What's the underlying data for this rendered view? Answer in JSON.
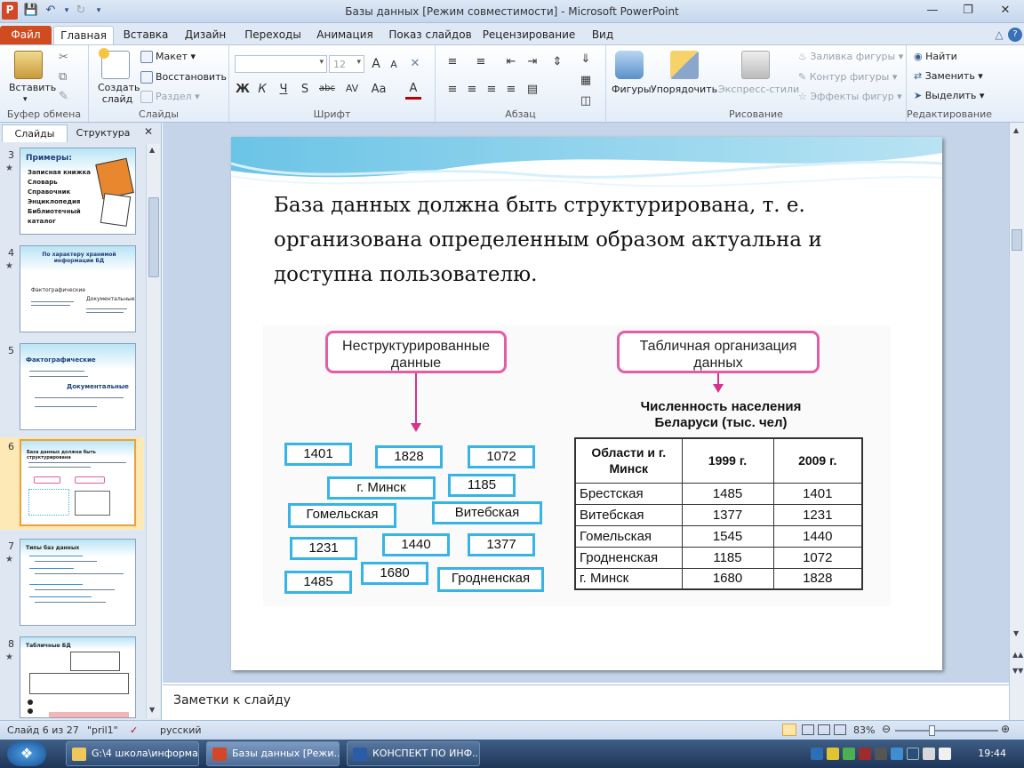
{
  "window": {
    "title": "Базы данных [Режим совместимости]  -  Microsoft PowerPoint",
    "app_icon": "P"
  },
  "ribbon_tabs": [
    "Файл",
    "Главная",
    "Вставка",
    "Дизайн",
    "Переходы",
    "Анимация",
    "Показ слайдов",
    "Рецензирование",
    "Вид"
  ],
  "ribbon": {
    "clipboard": {
      "paste": "Вставить",
      "group": "Буфер обмена"
    },
    "slides": {
      "new_slide": "Создать слайд",
      "layout": "Макет",
      "reset": "Восстановить",
      "section": "Раздел",
      "group": "Слайды"
    },
    "font": {
      "font_size": "12",
      "group": "Шрифт",
      "bold": "Ж",
      "italic": "К",
      "underline": "Ч",
      "shadow": "S",
      "strike": "abc",
      "spacing": "AV",
      "case": "Aa",
      "grow": "A",
      "shrink": "A",
      "color": "A"
    },
    "paragraph": {
      "group": "Абзац"
    },
    "drawing": {
      "shapes": "Фигуры",
      "arrange": "Упорядочить",
      "quick_styles": "Экспресс-стили",
      "fill": "Заливка фигуры",
      "outline": "Контур фигуры",
      "effects": "Эффекты фигур",
      "group": "Рисование"
    },
    "editing": {
      "find": "Найти",
      "replace": "Заменить",
      "select": "Выделить",
      "group": "Редактирование"
    }
  },
  "panel": {
    "tab_slides": "Слайды",
    "tab_outline": "Структура",
    "thumbnails": [
      {
        "num": "3",
        "title": "Примеры:",
        "lines": [
          "Записная книжка",
          "Словарь",
          "Справочник",
          "Энциклопедия",
          "Библиотечный каталог"
        ]
      },
      {
        "num": "4",
        "title": "По характеру хранимой информации БД",
        "lines": [
          "Фактографические",
          "Документальные"
        ]
      },
      {
        "num": "5",
        "title": "Фактографические",
        "lines": [
          "Документальные"
        ]
      },
      {
        "num": "6",
        "title": "База данных должна быть структурирована",
        "lines": []
      },
      {
        "num": "7",
        "title": "Типы баз данных",
        "lines": []
      },
      {
        "num": "8",
        "title": "Табличные БД",
        "lines": []
      }
    ]
  },
  "slide": {
    "line1": "База данных должна быть структурирована,  т.  е.",
    "line2": "организована  определенным  образом актуальна  и",
    "line3": "доступна  пользователю.",
    "figure": {
      "unstructured_label": "Неструктурированные данные",
      "tabular_label": "Табличная  организация данных",
      "scattered_items": [
        "1401",
        "1828",
        "1072",
        "г. Минск",
        "1185",
        "Гомельская",
        "Витебская",
        "1231",
        "1440",
        "1377",
        "1485",
        "1680",
        "Гродненская"
      ],
      "table_caption": "Численность населения Беларуси (тыс. чел)",
      "table_headers": [
        "Области и г. Минск",
        "1999 г.",
        "2009 г."
      ],
      "table_rows": [
        [
          "Брестская",
          "1485",
          "1401"
        ],
        [
          "Витебская",
          "1377",
          "1231"
        ],
        [
          "Гомельская",
          "1545",
          "1440"
        ],
        [
          "Гродненская",
          "1185",
          "1072"
        ],
        [
          "г. Минск",
          "1680",
          "1828"
        ]
      ]
    }
  },
  "notes": {
    "placeholder": "Заметки к слайду"
  },
  "status": {
    "slide_info": "Слайд 6 из 27",
    "theme": "\"pril1\"",
    "language": "русский",
    "zoom": "83%"
  },
  "taskbar": {
    "items": [
      "G:\\4 школа\\информа...",
      "Базы данных [Режи...",
      "КОНСПЕКТ ПО ИНФ..."
    ],
    "clock": "19:44"
  }
}
